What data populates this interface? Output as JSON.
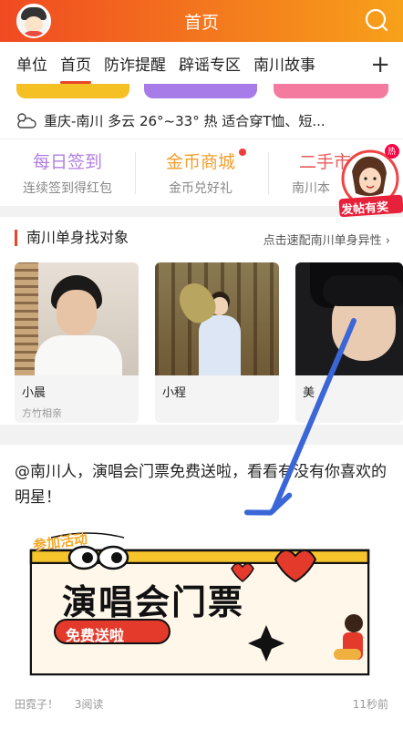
{
  "header": {
    "title": "首页"
  },
  "tabs": [
    {
      "label": "单位"
    },
    {
      "label": "首页"
    },
    {
      "label": "防诈提醒"
    },
    {
      "label": "辟谣专区"
    },
    {
      "label": "南川故事"
    }
  ],
  "weather": {
    "text": "重庆-南川 多云 26°~33° 热 适合穿T恤、短..."
  },
  "shortcuts": [
    {
      "title": "每日签到",
      "subtitle": "连续签到得红包",
      "color": "#b17fe0"
    },
    {
      "title": "金币商城",
      "subtitle": "金币兑好礼",
      "color": "#f0a030"
    },
    {
      "title": "二手市",
      "subtitle": "南川本",
      "color": "#e85a5a"
    }
  ],
  "float_badge": {
    "top": "热",
    "bottom": "发帖有奖"
  },
  "dating": {
    "title": "南川单身找对象",
    "more": "点击速配南川单身异性",
    "people": [
      {
        "name": "小晨",
        "sub": "方竹相亲"
      },
      {
        "name": "小程",
        "sub": ""
      },
      {
        "name": "美",
        "sub": ""
      }
    ]
  },
  "article": {
    "title": "@南川人，演唱会门票免费送啦，看看有没有你喜欢的明星！",
    "poster": {
      "tag": "参加活动",
      "headline": "演唱会门票",
      "sub": "免费送啦"
    },
    "author": "田霓子！",
    "reads": "3阅读",
    "time": "11秒前"
  }
}
